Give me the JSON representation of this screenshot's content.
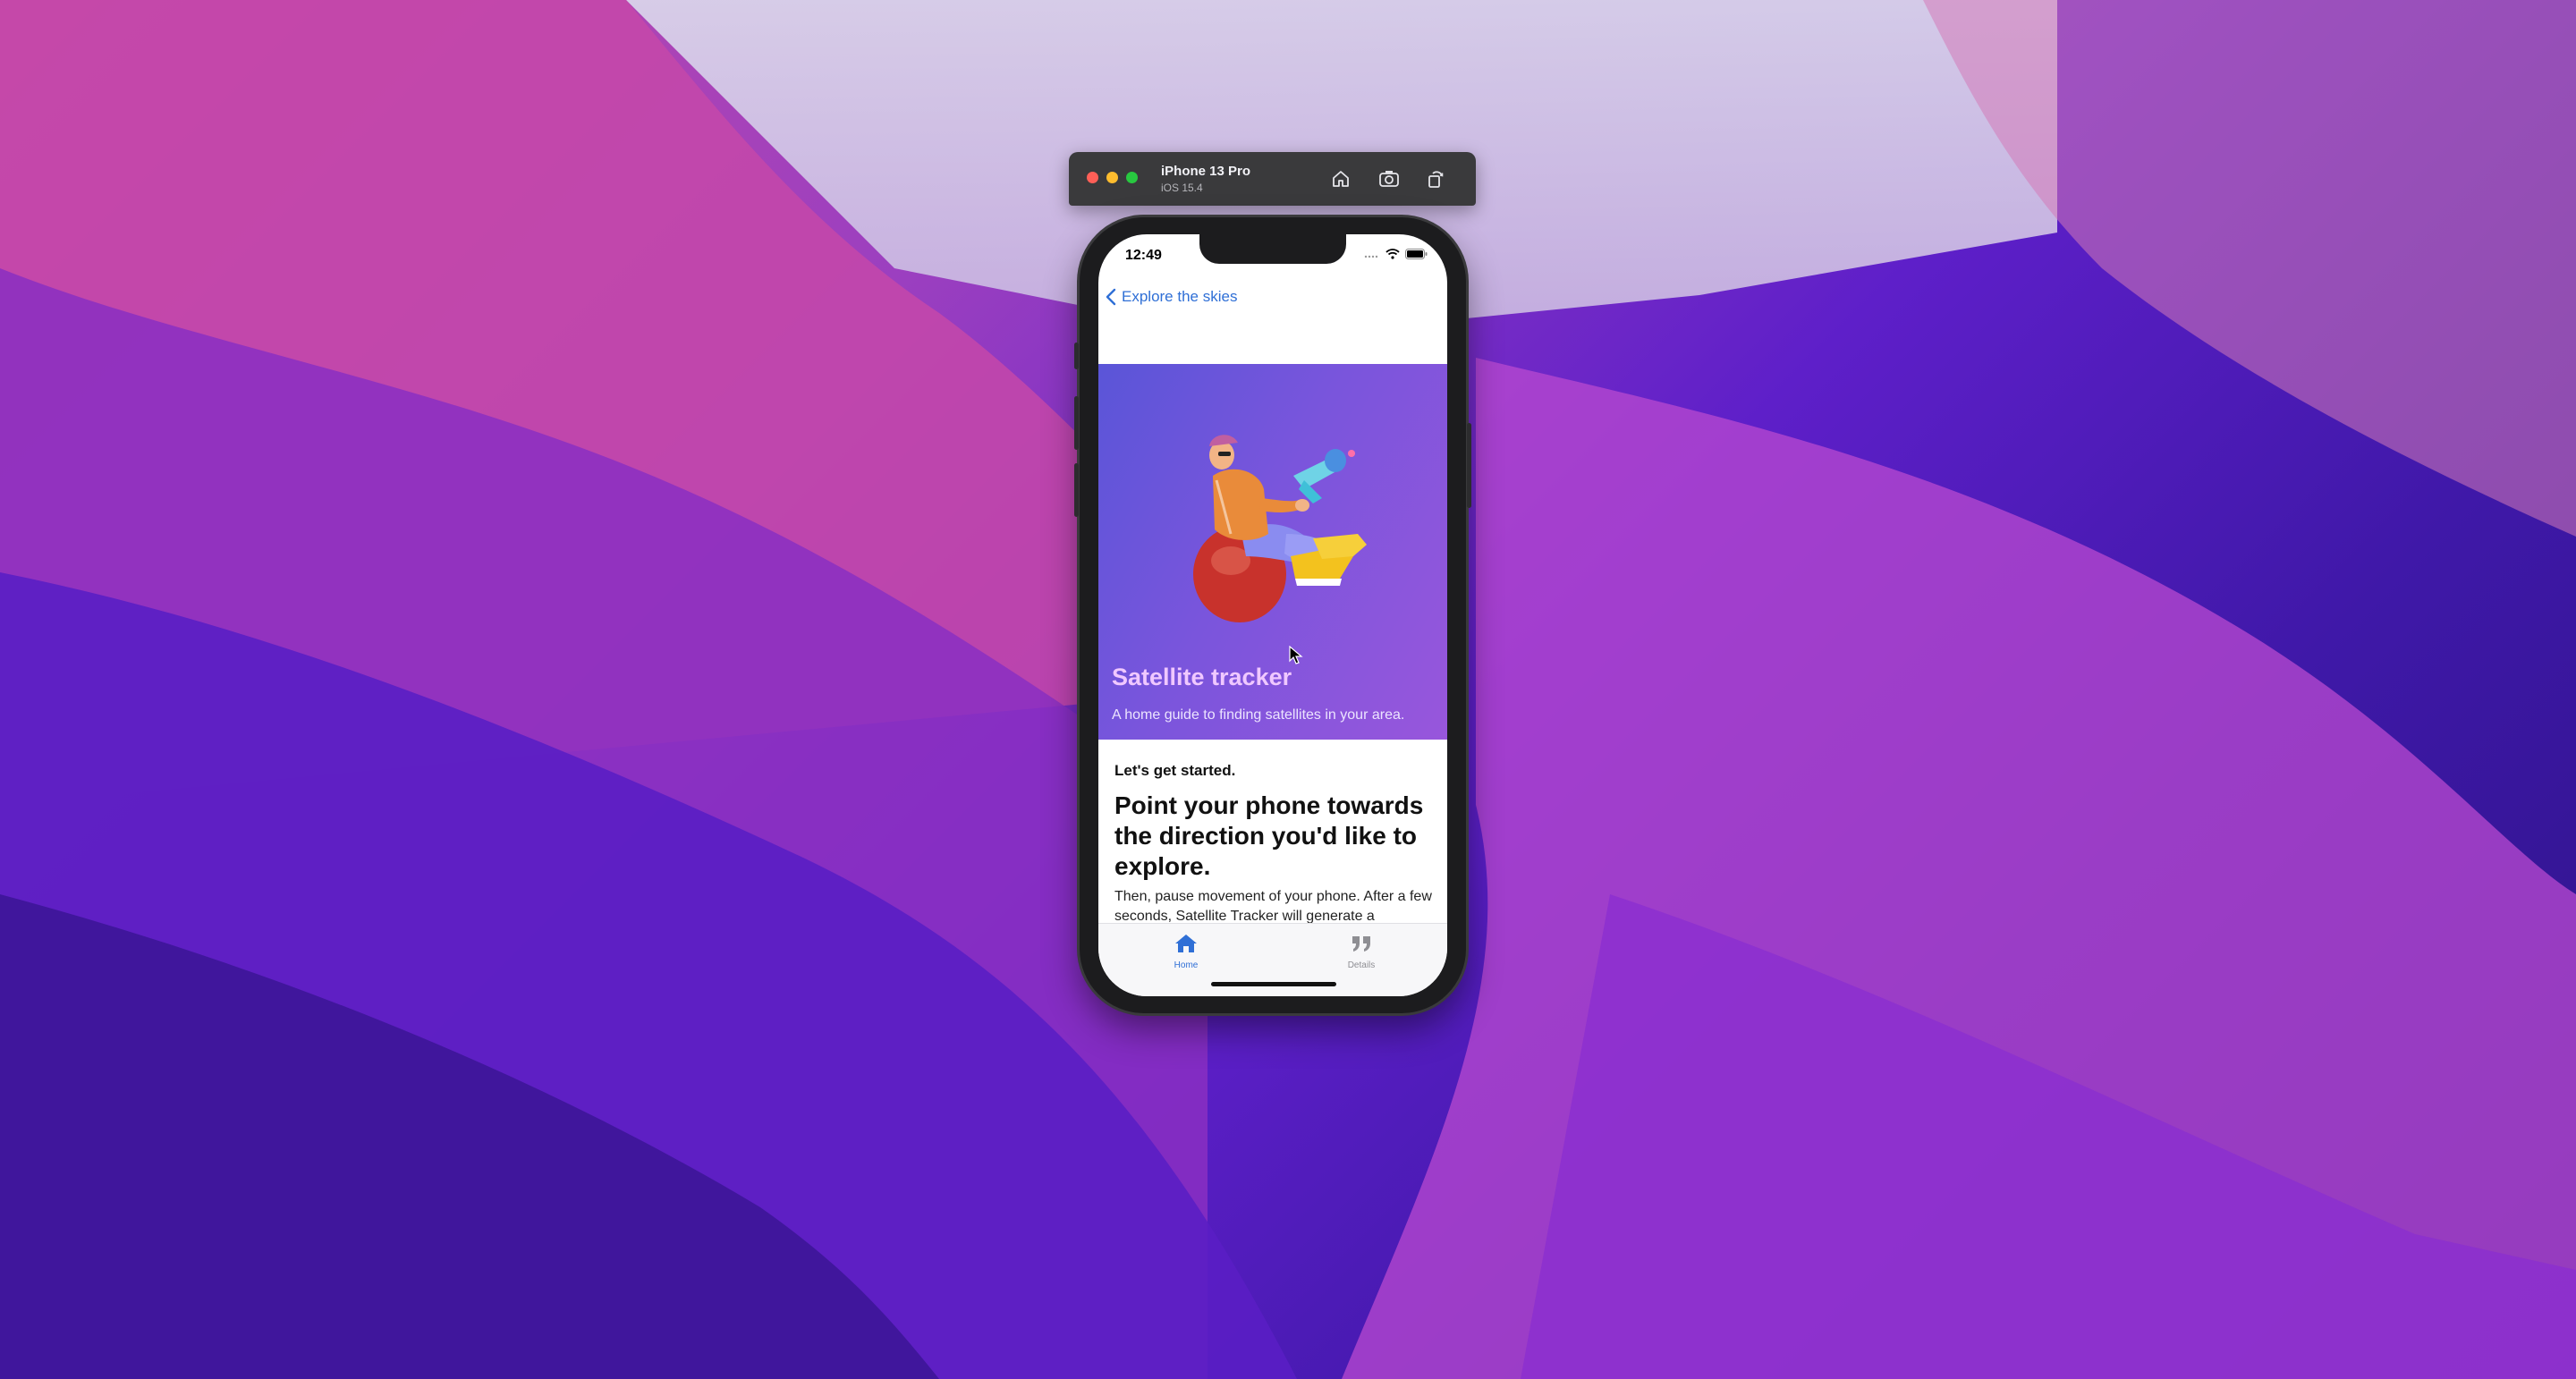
{
  "simulator": {
    "device_name": "iPhone 13 Pro",
    "os_version": "iOS 15.4",
    "toolbar_icons": [
      "home-icon",
      "screenshot-icon",
      "rotate-icon"
    ]
  },
  "status_bar": {
    "time": "12:49"
  },
  "navigation": {
    "back_label": "Explore the skies"
  },
  "hero": {
    "title": "Satellite tracker",
    "subtitle": "A home guide to finding satellites in your area."
  },
  "content": {
    "intro": "Let's get started.",
    "headline": "Point your phone towards the direction you'd like to explore.",
    "body": "Then, pause movement of your phone. After a few seconds, Satellite Tracker will generate a"
  },
  "tab_bar": {
    "items": [
      {
        "label": "Home",
        "icon": "house-icon",
        "selected": true
      },
      {
        "label": "Details",
        "icon": "quote-icon",
        "selected": false
      }
    ]
  },
  "colors": {
    "accent": "#2f6fd6",
    "hero_gradient_start": "#5a55d8",
    "hero_gradient_end": "#9856dc",
    "hero_title": "#f0c8ff"
  }
}
